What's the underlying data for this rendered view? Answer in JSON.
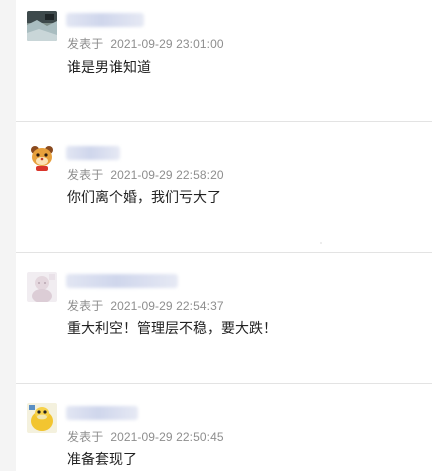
{
  "comments": [
    {
      "avatar_icon": "avatar-photo-landscape",
      "posted_label": "发表于",
      "timestamp": "2021-09-29 23:01:00",
      "text": "谁是男谁知道"
    },
    {
      "avatar_icon": "avatar-cartoon-tiger",
      "posted_label": "发表于",
      "timestamp": "2021-09-29 22:58:20",
      "text": "你们离个婚，我们亏大了"
    },
    {
      "avatar_icon": "avatar-pale-figure",
      "posted_label": "发表于",
      "timestamp": "2021-09-29 22:54:37",
      "text": "重大利空！管理层不稳，要大跌！"
    },
    {
      "avatar_icon": "avatar-yellow-duck",
      "posted_label": "发表于",
      "timestamp": "2021-09-29 22:50:45",
      "text": "准备套现了"
    }
  ]
}
